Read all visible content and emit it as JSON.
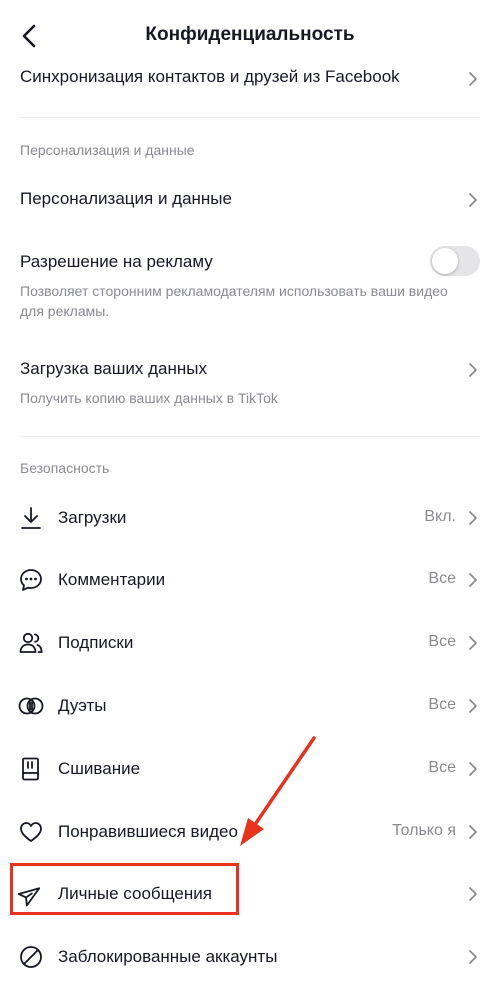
{
  "header": {
    "title": "Конфиденциальность"
  },
  "top_item": {
    "label": "Синхронизация контактов и друзей из Facebook"
  },
  "personalization": {
    "section_label": "Персонализация и данные",
    "items": [
      {
        "label": "Персонализация и данные"
      },
      {
        "label": "Разрешение на рекламу",
        "description": "Позволяет сторонним рекламодателям использовать ваши видео для рекламы.",
        "toggle_on": false
      },
      {
        "label": "Загрузка ваших данных",
        "description": "Получить копию ваших данных в TikTok"
      }
    ]
  },
  "security": {
    "section_label": "Безопасность",
    "items": [
      {
        "label": "Загрузки",
        "value": "Вкл.",
        "icon": "download-icon"
      },
      {
        "label": "Комментарии",
        "value": "Все",
        "icon": "comment-icon"
      },
      {
        "label": "Подписки",
        "value": "Все",
        "icon": "users-icon"
      },
      {
        "label": "Дуэты",
        "value": "Все",
        "icon": "duet-icon"
      },
      {
        "label": "Сшивание",
        "value": "Все",
        "icon": "stitch-icon"
      },
      {
        "label": "Понравившиеся видео",
        "value": "Только я",
        "icon": "heart-icon"
      },
      {
        "label": "Личные сообщения",
        "icon": "send-icon"
      },
      {
        "label": "Заблокированные аккаунты",
        "icon": "blocked-icon"
      }
    ]
  },
  "colors": {
    "annotation": "#e8321c",
    "secondary_text": "#8a8b91",
    "primary_text": "#161823"
  }
}
